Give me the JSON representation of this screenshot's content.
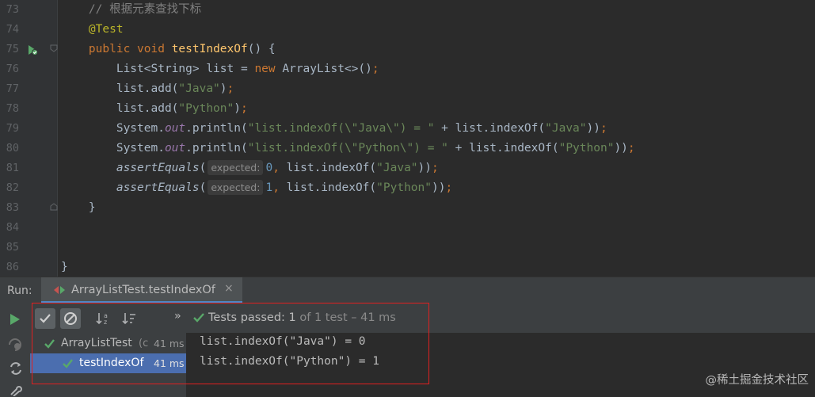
{
  "editor": {
    "lines": [
      {
        "num": "73",
        "parts": [
          [
            "cm",
            "    // 根据元素查找下标"
          ]
        ]
      },
      {
        "num": "74",
        "parts": [
          [
            "ann",
            "    @Test"
          ]
        ]
      },
      {
        "num": "75",
        "parts": [
          [
            "kw",
            "    public void "
          ],
          [
            "fn",
            "testIndexOf"
          ],
          [
            "",
            "() {"
          ]
        ]
      },
      {
        "num": "76",
        "parts": [
          [
            "",
            "        List<String> list = "
          ],
          [
            "kw",
            "new "
          ],
          [
            "",
            "ArrayList<>()"
          ],
          [
            "kw",
            ";"
          ]
        ]
      },
      {
        "num": "77",
        "parts": [
          [
            "",
            "        list.add("
          ],
          [
            "str",
            "\"Java\""
          ],
          [
            "",
            ")"
          ],
          [
            "kw",
            ";"
          ]
        ]
      },
      {
        "num": "78",
        "parts": [
          [
            "",
            "        list.add("
          ],
          [
            "str",
            "\"Python\""
          ],
          [
            "",
            ")"
          ],
          [
            "kw",
            ";"
          ]
        ]
      },
      {
        "num": "79",
        "parts": [
          [
            "",
            "        System."
          ],
          [
            "sf",
            "out"
          ],
          [
            "",
            ".println("
          ],
          [
            "str",
            "\"list.indexOf(\\\"Java\\\") = \""
          ],
          [
            "",
            " + list.indexOf("
          ],
          [
            "str",
            "\"Java\""
          ],
          [
            "",
            "))"
          ],
          [
            "kw",
            ";"
          ]
        ]
      },
      {
        "num": "80",
        "parts": [
          [
            "",
            "        System."
          ],
          [
            "sf",
            "out"
          ],
          [
            "",
            ".println("
          ],
          [
            "str",
            "\"list.indexOf(\\\"Python\\\") = \""
          ],
          [
            "",
            " + list.indexOf("
          ],
          [
            "str",
            "\"Python\""
          ],
          [
            "",
            "))"
          ],
          [
            "kw",
            ";"
          ]
        ]
      },
      {
        "num": "81",
        "parts": [
          [
            "it",
            "        assertEquals"
          ],
          [
            "",
            "("
          ],
          [
            "hint",
            "expected:"
          ],
          [
            "num",
            "0"
          ],
          [
            "kw",
            ", "
          ],
          [
            "",
            "list.indexOf("
          ],
          [
            "str",
            "\"Java\""
          ],
          [
            "",
            "))"
          ],
          [
            "kw",
            ";"
          ]
        ]
      },
      {
        "num": "82",
        "parts": [
          [
            "it",
            "        assertEquals"
          ],
          [
            "",
            "("
          ],
          [
            "hint",
            "expected:"
          ],
          [
            "num",
            "1"
          ],
          [
            "kw",
            ", "
          ],
          [
            "",
            "list.indexOf("
          ],
          [
            "str",
            "\"Python\""
          ],
          [
            "",
            "))"
          ],
          [
            "kw",
            ";"
          ]
        ]
      },
      {
        "num": "83",
        "parts": [
          [
            "",
            "    }"
          ]
        ]
      },
      {
        "num": "84",
        "parts": []
      },
      {
        "num": "85",
        "parts": []
      },
      {
        "num": "86",
        "parts": [
          [
            "",
            "}"
          ]
        ]
      }
    ]
  },
  "run_panel": {
    "label": "Run:",
    "tab_title": "ArrayListTest.testIndexOf",
    "status_prefix": "Tests passed: ",
    "status_count": "1",
    "status_rest": " of 1 test – 41 ms",
    "tree": [
      {
        "name": "ArrayListTest",
        "suffix": " (c",
        "time": "41 ms",
        "selected": false
      },
      {
        "name": "testIndexOf",
        "suffix": "",
        "time": "41 ms",
        "selected": true
      }
    ],
    "console_lines": [
      "list.indexOf(\"Java\") = 0",
      "list.indexOf(\"Python\") = 1"
    ]
  },
  "colors": {
    "accent": "#4a88c7",
    "pass_green": "#59a869",
    "highlight_box": "#e02020"
  },
  "watermark": "@稀土掘金技术社区"
}
